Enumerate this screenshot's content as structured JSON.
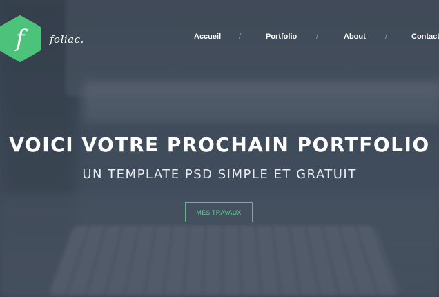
{
  "brand": {
    "logo_letter": "f",
    "name": "foliac.",
    "logo_color": "#4cc27a",
    "logo_icon": "hexagon-logo-icon"
  },
  "nav": {
    "items": [
      {
        "label": "Accueil"
      },
      {
        "label": "Portfolio"
      },
      {
        "label": "About"
      },
      {
        "label": "Contact"
      }
    ],
    "separator": "/"
  },
  "hero": {
    "headline": "VOICI VOTRE PROCHAIN PORTFOLIO",
    "subheadline": "UN TEMPLATE PSD SIMPLE ET GRATUIT",
    "cta_label": "MES TRAVAUX",
    "accent_color": "#4fc281"
  }
}
